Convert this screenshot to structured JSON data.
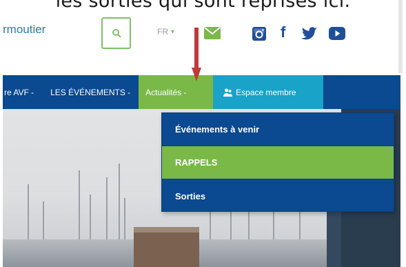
{
  "caption": "les sorties qui sont reprises ici.",
  "site_name": "rmoutier",
  "language": {
    "code": "FR",
    "caret": "▾"
  },
  "icons": {
    "search": "search-icon",
    "envelope": "envelope-icon",
    "instagram": "instagram-icon",
    "facebook": "facebook-icon",
    "twitter": "twitter-icon",
    "youtube": "youtube-icon",
    "annotation_arrow": "down-arrow-icon"
  },
  "facebook_glyph": "f",
  "nav": {
    "items": [
      {
        "label": "re AVF -"
      },
      {
        "label": "LES ÉVÉNEMENTS -"
      },
      {
        "label": "Actualités -"
      },
      {
        "label": "Espace membre"
      }
    ]
  },
  "dropdown": {
    "items": [
      {
        "label": "Événements à venir"
      },
      {
        "label": "RAPPELS"
      },
      {
        "label": "Sorties"
      }
    ]
  },
  "colors": {
    "nav_blue": "#0b4990",
    "active_green": "#7ab948",
    "member_teal": "#19a3c8",
    "arrow_red": "#c0393b",
    "site_blue": "#2b7fb0"
  }
}
